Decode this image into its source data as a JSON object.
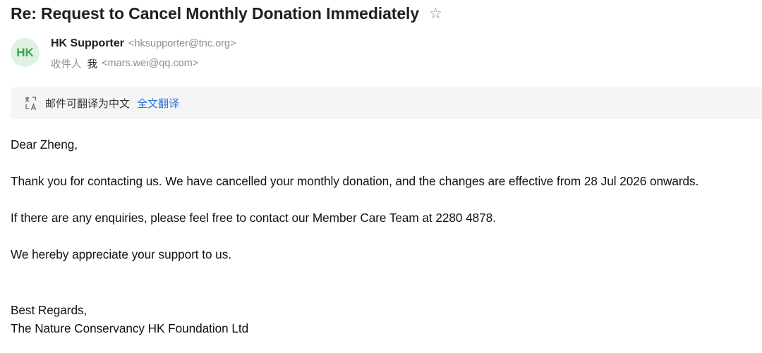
{
  "email": {
    "subject": "Re: Request to Cancel Monthly Donation Immediately",
    "star_glyph": "☆",
    "sender": {
      "avatar_initials": "HK",
      "name": "HK Supporter",
      "email": "<hksupporter@tnc.org>"
    },
    "recipient": {
      "label": "收件人",
      "name": "我",
      "email": "<mars.wei@qq.com>"
    },
    "translate_bar": {
      "icon": "translate-icon",
      "text": "邮件可翻译为中文",
      "link": "全文翻译"
    },
    "body": {
      "greeting": "Dear Zheng,",
      "paragraph_1": "Thank you for contacting us. We have cancelled your monthly donation, and the changes are effective from 28 Jul 2026 onwards.",
      "paragraph_2": "If there are any enquiries, please feel free to contact our Member Care Team at 2280 4878.",
      "paragraph_3": "We hereby appreciate your support to us.",
      "closing": "Best Regards,",
      "signature": "The Nature Conservancy HK Foundation Ltd"
    }
  },
  "colors": {
    "avatar_bg": "#dff2e1",
    "avatar_text": "#3aa54a",
    "link": "#2f6fd0",
    "translate_bar_bg": "#f3f5f7",
    "muted_text": "#8c8c8c"
  }
}
